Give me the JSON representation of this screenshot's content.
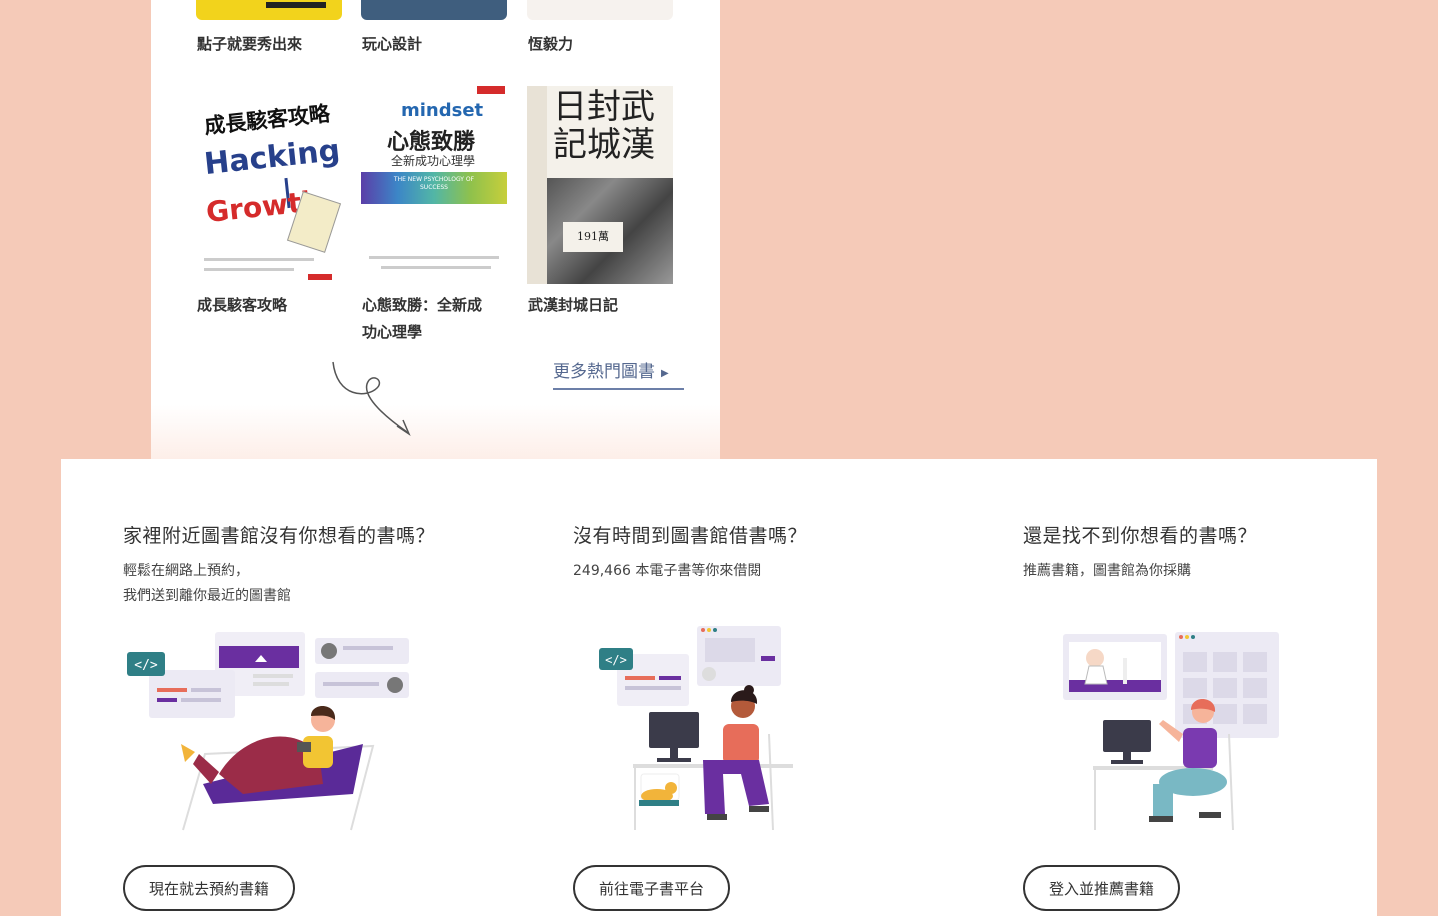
{
  "books_top_row": [
    {
      "title": "點子就要秀出來"
    },
    {
      "title": "玩心設計"
    },
    {
      "title": "恆毅力"
    }
  ],
  "books_bottom_row": [
    {
      "title": "成長駭客攻略",
      "cover_heading": "成長駭客攻略",
      "cover_en_1": "Hacking",
      "cover_en_2": "Growth"
    },
    {
      "title_line1": "心態致勝：全新成",
      "title_line2": "功心理學",
      "cover_en": "mindset",
      "cover_heading": "心態致勝",
      "cover_sub": "全新成功心理學",
      "cover_en_sub": "THE NEW PSYCHOLOGY OF SUCCESS"
    },
    {
      "title": "武漢封城日記",
      "cover_heading_1": "日封武",
      "cover_heading_2": "記城漢",
      "cover_badge": "191萬"
    }
  ],
  "more_books_link": "更多熱門圖書",
  "services": [
    {
      "heading": "家裡附近圖書館沒有你想看的書嗎？",
      "desc_line1": "輕鬆在網路上預約，",
      "desc_line2": "我們送到離你最近的圖書館",
      "button": "現在就去預約書籍",
      "code_tag": "</>"
    },
    {
      "heading": "沒有時間到圖書館借書嗎？",
      "desc_line1": "249,466 本電子書等你來借閱",
      "button": "前往電子書平台",
      "code_tag": "</>"
    },
    {
      "heading": "還是找不到你想看的書嗎？",
      "desc_line1": "推薦書籍，圖書館為你採購",
      "button": "登入並推薦書籍"
    }
  ],
  "colors": {
    "page_bg": "#f5cab8",
    "accent_purple": "#6a2fa0",
    "teal": "#2f7f86",
    "link": "#55688f"
  }
}
